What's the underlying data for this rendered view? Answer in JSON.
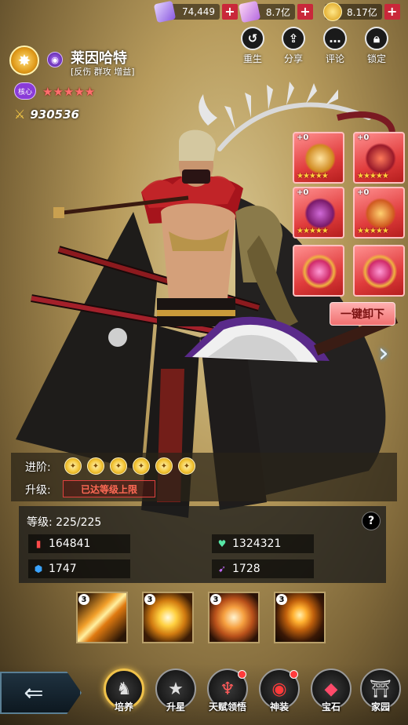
{
  "currencies": [
    {
      "name": "ticket",
      "value": "74,449",
      "color": "#b58cff"
    },
    {
      "name": "scroll",
      "value": "8.7亿",
      "color": "#d9a4ff"
    },
    {
      "name": "gold",
      "value": "8.17亿",
      "color": "#f3c433"
    }
  ],
  "actions": [
    {
      "icon": "undo-icon",
      "label": "重生"
    },
    {
      "icon": "share-icon",
      "label": "分享"
    },
    {
      "icon": "comment-icon",
      "label": "评论"
    },
    {
      "icon": "lock-icon",
      "label": "锁定"
    }
  ],
  "hero": {
    "name": "莱因哈特",
    "tags": "[反伤 群攻 增益]",
    "core_badge": "核心",
    "stars": "★★★★★",
    "power": "930536",
    "element_icon": "dark-element-icon"
  },
  "equipment": [
    {
      "level": "+0",
      "stars": "★★★★★",
      "icon": "scepter-icon"
    },
    {
      "level": "+0",
      "stars": "★★★★★",
      "icon": "armor-icon"
    },
    {
      "level": "+0",
      "stars": "★★★★★",
      "icon": "helmet-icon"
    },
    {
      "level": "+0",
      "stars": "★★★★★",
      "icon": "wings-icon"
    },
    {
      "level": "",
      "stars": "",
      "icon": "gem-slot-icon"
    },
    {
      "level": "",
      "stars": "",
      "icon": "gem-slot-icon"
    }
  ],
  "unequip_label": "一键卸下",
  "advance": {
    "label": "进阶:",
    "count": 6
  },
  "upgrade": {
    "label": "升级:",
    "status": "已达等级上限"
  },
  "level": {
    "label": "等级:",
    "value": "225/225"
  },
  "stats": [
    {
      "icon": "attack-icon",
      "value": "164841",
      "color": "#ff4a4a"
    },
    {
      "icon": "hp-icon",
      "value": "1324321",
      "color": "#57e6a6"
    },
    {
      "icon": "defense-icon",
      "value": "1747",
      "color": "#3aa3ff"
    },
    {
      "icon": "speed-icon",
      "value": "1728",
      "color": "#c76bff"
    }
  ],
  "skills": [
    {
      "level": "3",
      "icon": "lightning-slash-skill-icon"
    },
    {
      "level": "3",
      "icon": "sun-burst-skill-icon"
    },
    {
      "level": "3",
      "icon": "explosion-skill-icon"
    },
    {
      "level": "3",
      "icon": "fire-ring-skill-icon"
    }
  ],
  "nav": [
    {
      "label": "培养",
      "icon": "horse-icon",
      "active": true,
      "badge": false
    },
    {
      "label": "升星",
      "icon": "star-icon",
      "active": false,
      "badge": false
    },
    {
      "label": "天赋领悟",
      "icon": "talent-icon",
      "active": false,
      "badge": true
    },
    {
      "label": "神装",
      "icon": "artifact-icon",
      "active": false,
      "badge": true
    },
    {
      "label": "宝石",
      "icon": "gem-icon",
      "active": false,
      "badge": false
    },
    {
      "label": "家园",
      "icon": "gate-icon",
      "active": false,
      "badge": false
    }
  ]
}
